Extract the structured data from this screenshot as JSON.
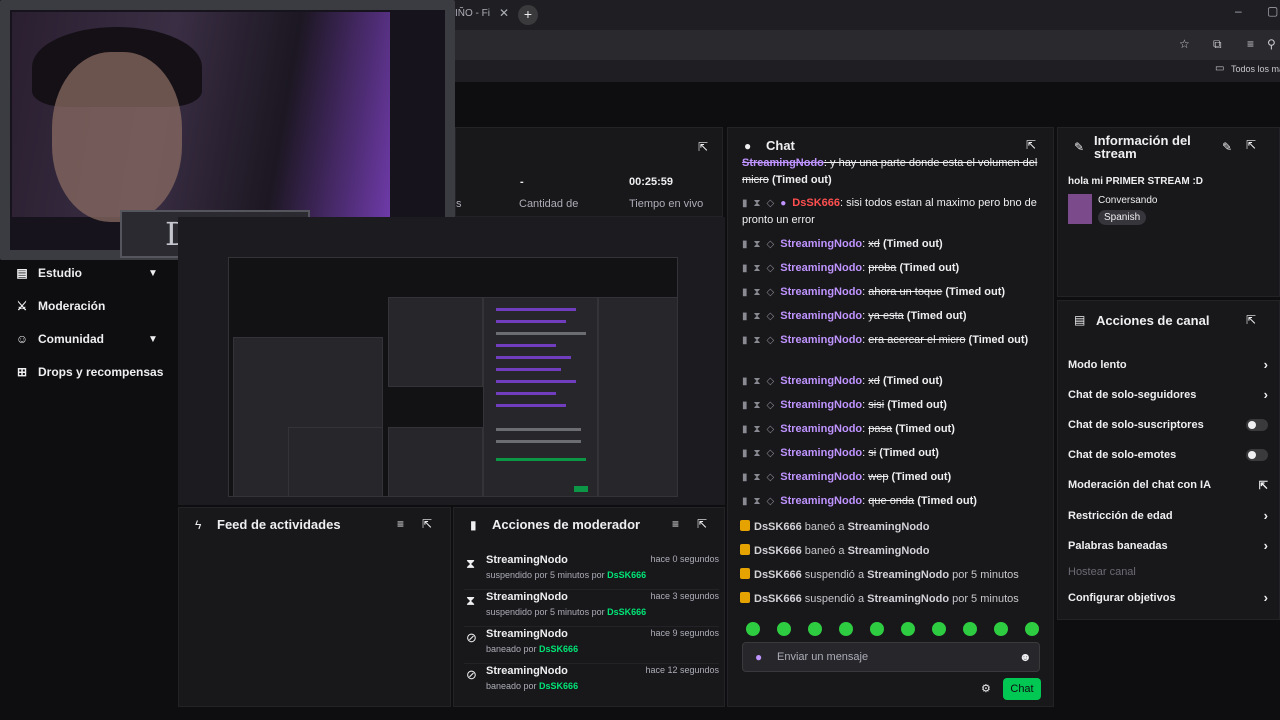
{
  "browser": {
    "tab_title": "IÑO - Fi",
    "bookmark": "Todos los ma"
  },
  "overlay": {
    "logo_text": "DsSK"
  },
  "nav": {
    "items": [
      {
        "label": "Estudio"
      },
      {
        "label": "Moderación"
      },
      {
        "label": "Comunidad"
      },
      {
        "label": "Drops y recompensas"
      }
    ]
  },
  "stats": {
    "values": [
      "-",
      "00:25:59"
    ],
    "labels": [
      "s",
      "Cantidad de",
      "Tiempo en vivo"
    ]
  },
  "chat": {
    "title": "Chat",
    "messages": [
      {
        "user": "StreamingNodo",
        "text": ": y hay una parte donde esta el volumen del micro",
        "suffix": " (Timed out)"
      },
      {
        "user": "DsSK666",
        "text": ": sisi todos estan al maximo pero bno de pronto un error",
        "suffix": ""
      },
      {
        "user": "StreamingNodo",
        "text": "xd",
        "suffix": " (Timed out)"
      },
      {
        "user": "StreamingNodo",
        "text": "proba",
        "suffix": " (Timed out)"
      },
      {
        "user": "StreamingNodo",
        "text": "ahora un toque",
        "suffix": " (Timed out)"
      },
      {
        "user": "StreamingNodo",
        "text": "ya esta",
        "suffix": " (Timed out)"
      },
      {
        "user": "StreamingNodo",
        "text": "era acercar el micro",
        "suffix": " (Timed out)"
      },
      {
        "user": "StreamingNodo",
        "text": "xd",
        "suffix": " (Timed out)"
      },
      {
        "user": "StreamingNodo",
        "text": "sisi",
        "suffix": " (Timed out)"
      },
      {
        "user": "StreamingNodo",
        "text": "pasa",
        "suffix": " (Timed out)"
      },
      {
        "user": "StreamingNodo",
        "text": "si",
        "suffix": " (Timed out)"
      },
      {
        "user": "StreamingNodo",
        "text": "wep",
        "suffix": " (Timed out)"
      },
      {
        "user": "StreamingNodo",
        "text": "que onda",
        "suffix": " (Timed out)"
      }
    ],
    "mod_events": [
      {
        "actor": "DsSK666",
        "verb": " baneó a ",
        "target": "StreamingNodo",
        "extra": ""
      },
      {
        "actor": "DsSK666",
        "verb": " baneó a ",
        "target": "StreamingNodo",
        "extra": ""
      },
      {
        "actor": "DsSK666",
        "verb": " suspendió a ",
        "target": "StreamingNodo",
        "extra": " por 5 minutos"
      },
      {
        "actor": "DsSK666",
        "verb": " suspendió a ",
        "target": "StreamingNodo",
        "extra": " por 5 minutos"
      }
    ],
    "input_placeholder": "Enviar un mensaje",
    "send_label": "Chat"
  },
  "info": {
    "title": "Información del stream",
    "stream_title": "hola mi PRIMER STREAM :D",
    "category": "Conversando",
    "tag": "Spanish"
  },
  "channel_actions": {
    "title": "Acciones de canal",
    "items": [
      {
        "label": "Modo lento",
        "control": "arrow"
      },
      {
        "label": "Chat de solo-seguidores",
        "control": "arrow"
      },
      {
        "label": "Chat de solo-suscriptores",
        "control": "toggle"
      },
      {
        "label": "Chat de solo-emotes",
        "control": "toggle"
      },
      {
        "label": "Moderación del chat con IA",
        "control": "external"
      },
      {
        "label": "Restricción de edad",
        "control": "arrow"
      },
      {
        "label": "Palabras baneadas",
        "control": "arrow"
      },
      {
        "label": "Hostear canal",
        "control": "none"
      },
      {
        "label": "Configurar objetivos",
        "control": "arrow"
      }
    ]
  },
  "feed": {
    "title": "Feed de actividades"
  },
  "mod_actions": {
    "title": "Acciones de moderador",
    "rows": [
      {
        "user": "StreamingNodo",
        "sub": "suspendido por 5 minutos por ",
        "by": "DsSK666",
        "time": "hace 0 segundos",
        "icon": "hourglass-icon"
      },
      {
        "user": "StreamingNodo",
        "sub": "suspendido por 5 minutos por ",
        "by": "DsSK666",
        "time": "hace 3 segundos",
        "icon": "hourglass-icon"
      },
      {
        "user": "StreamingNodo",
        "sub": "baneado por ",
        "by": "DsSK666",
        "time": "hace 9 segundos",
        "icon": "ban-icon"
      },
      {
        "user": "StreamingNodo",
        "sub": "baneado por ",
        "by": "DsSK666",
        "time": "hace 12 segundos",
        "icon": "ban-icon"
      }
    ]
  },
  "colors": {
    "accent": "#9147ff",
    "username": "#bf94ff",
    "send_button": "#00c853",
    "mod_name": "#00e676"
  }
}
